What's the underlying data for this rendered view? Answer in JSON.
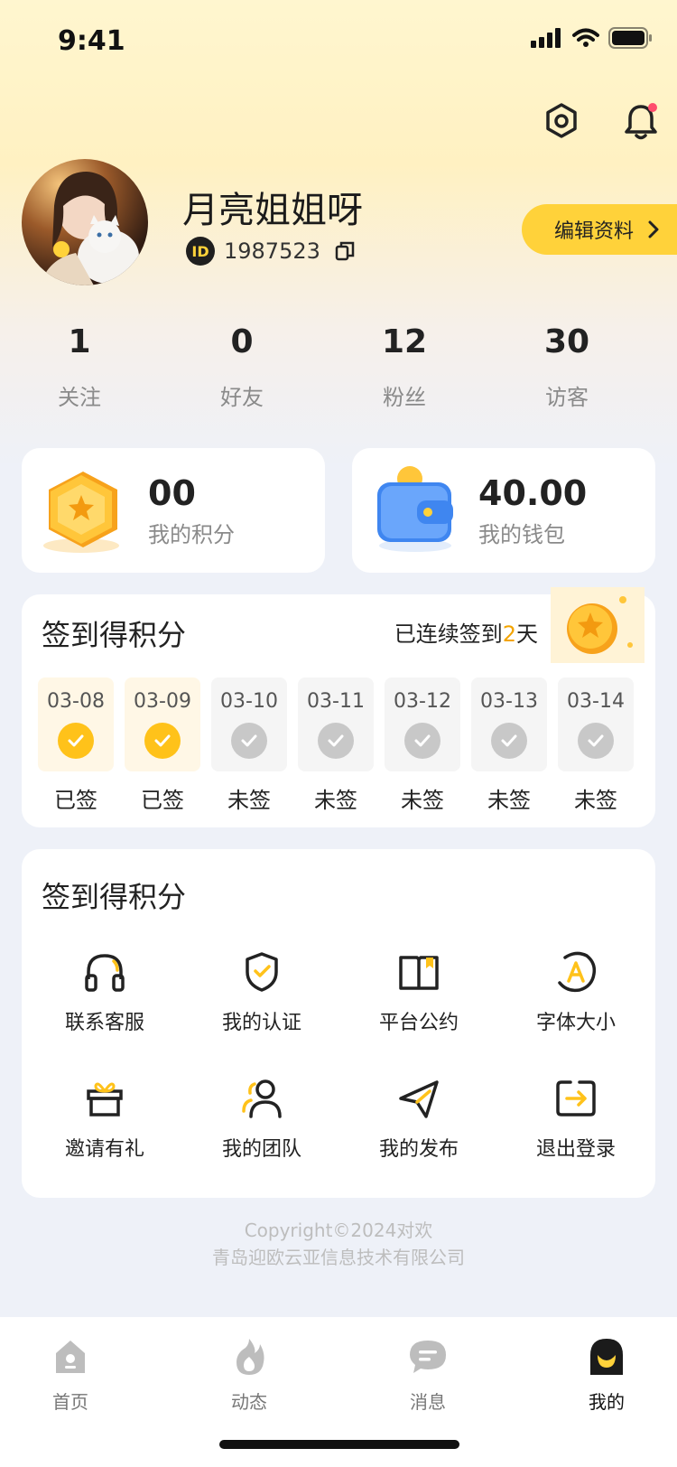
{
  "status_bar": {
    "time": "9:41"
  },
  "profile": {
    "name": "月亮姐姐呀",
    "id_badge": "ID",
    "id": "1987523",
    "edit_label": "编辑资料"
  },
  "stats": [
    {
      "value": "1",
      "label": "关注"
    },
    {
      "value": "0",
      "label": "好友"
    },
    {
      "value": "12",
      "label": "粉丝"
    },
    {
      "value": "30",
      "label": "访客"
    }
  ],
  "points": {
    "value": "00",
    "label": "我的积分"
  },
  "wallet": {
    "value": "40.00",
    "label": "我的钱包"
  },
  "checkin": {
    "title": "签到得积分",
    "streak_prefix": "已连续签到",
    "streak_days": "2",
    "streak_suffix": "天",
    "days": [
      {
        "date": "03-08",
        "status": "已签"
      },
      {
        "date": "03-09",
        "status": "已签"
      },
      {
        "date": "03-10",
        "status": "未签"
      },
      {
        "date": "03-11",
        "status": "未签"
      },
      {
        "date": "03-12",
        "status": "未签"
      },
      {
        "date": "03-13",
        "status": "未签"
      },
      {
        "date": "03-14",
        "status": "未签"
      }
    ]
  },
  "menu": {
    "title": "签到得积分",
    "items": [
      {
        "label": "联系客服",
        "icon": "headset-icon"
      },
      {
        "label": "我的认证",
        "icon": "shield-check-icon"
      },
      {
        "label": "平台公约",
        "icon": "book-icon"
      },
      {
        "label": "字体大小",
        "icon": "font-size-icon"
      },
      {
        "label": "邀请有礼",
        "icon": "gift-icon"
      },
      {
        "label": "我的团队",
        "icon": "team-icon"
      },
      {
        "label": "我的发布",
        "icon": "send-icon"
      },
      {
        "label": "退出登录",
        "icon": "logout-icon"
      }
    ]
  },
  "copyright": {
    "line1": "Copyright©2024对欢",
    "line2": "青岛迎欧云亚信息技术有限公司"
  },
  "tabbar": [
    {
      "label": "首页",
      "icon": "home-icon"
    },
    {
      "label": "动态",
      "icon": "flame-icon"
    },
    {
      "label": "消息",
      "icon": "message-icon"
    },
    {
      "label": "我的",
      "icon": "profile-icon"
    }
  ],
  "colors": {
    "accent": "#ffd23a",
    "checked": "#ffc21a",
    "unchecked": "#c8c8c8"
  }
}
